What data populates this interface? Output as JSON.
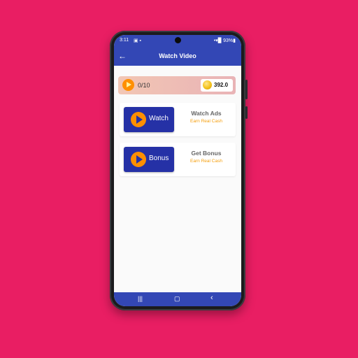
{
  "status_bar": {
    "time": "3:11",
    "notifications": "▣ ▪",
    "right_text": "•▾▉ 93%▮"
  },
  "app_bar": {
    "title": "Watch Video",
    "back_icon": "←"
  },
  "progress": {
    "value": "0/10",
    "coins": "392.0"
  },
  "cards": [
    {
      "button_label": "Watch",
      "title": "Watch Ads",
      "subtitle": "Earn Real Cash"
    },
    {
      "button_label": "Bonus",
      "title": "Get Bonus",
      "subtitle": "Earn Real Cash"
    }
  ],
  "nav_bar": {
    "recents": "|||",
    "home": "▢",
    "back": "‹"
  },
  "colors": {
    "background": "#E91E63",
    "app_bar": "#3347b5",
    "button": "#2531a6",
    "accent_orange": "#FF8F00",
    "subtitle": "#F59E0B"
  }
}
